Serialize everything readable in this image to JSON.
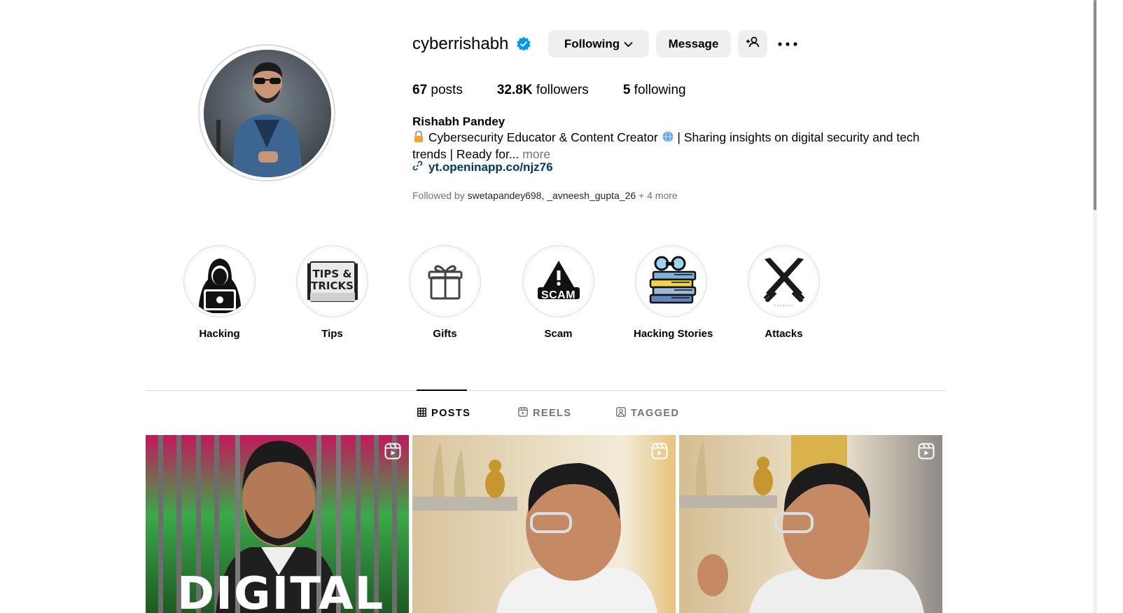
{
  "profile": {
    "username": "cyberrishabh",
    "verified_icon": "verified-badge-icon",
    "buttons": {
      "following": "Following",
      "message": "Message",
      "add_user_icon": "add-user-icon",
      "more_icon": "more-options-icon"
    },
    "stats": {
      "posts_count": "67",
      "posts_label": "posts",
      "followers_count": "32.8K",
      "followers_label": "followers",
      "following_count": "5",
      "following_label": "following"
    },
    "full_name": "Rishabh Pandey",
    "bio_text": "Cybersecurity Educator & Content Creator",
    "bio_text2": "| Sharing insights on digital security and tech trends | Ready for...",
    "bio_more": "more",
    "link": "yt.openinapp.co/njz76",
    "followed_by_prefix": "Followed by",
    "followed_by_user1": "swetapandey698",
    "followed_by_sep": ",",
    "followed_by_user2": "_avneesh_gupta_26",
    "followed_by_more": "+ 4 more"
  },
  "highlights": [
    {
      "label": "Hacking",
      "icon": "hacker-icon"
    },
    {
      "label": "Tips",
      "icon": "tips-tricks-icon",
      "badge_line1": "TIPS &",
      "badge_line2": "TRICKS"
    },
    {
      "label": "Gifts",
      "icon": "gift-icon"
    },
    {
      "label": "Scam",
      "icon": "scam-warning-icon",
      "badge_text": "SCAM"
    },
    {
      "label": "Hacking Stories",
      "icon": "books-icon"
    },
    {
      "label": "Attacks",
      "icon": "crossed-swords-icon"
    }
  ],
  "tabs": [
    {
      "label": "POSTS",
      "icon": "grid-icon",
      "active": true
    },
    {
      "label": "REELS",
      "icon": "reels-icon",
      "active": false
    },
    {
      "label": "TAGGED",
      "icon": "tagged-icon",
      "active": false
    }
  ],
  "posts": [
    {
      "type": "reel",
      "overlay_text": "DIGITAL"
    },
    {
      "type": "reel"
    },
    {
      "type": "reel"
    }
  ],
  "colors": {
    "link": "#00376b",
    "verified": "#0095f6",
    "button_bg": "#efefef",
    "muted": "#737373"
  }
}
